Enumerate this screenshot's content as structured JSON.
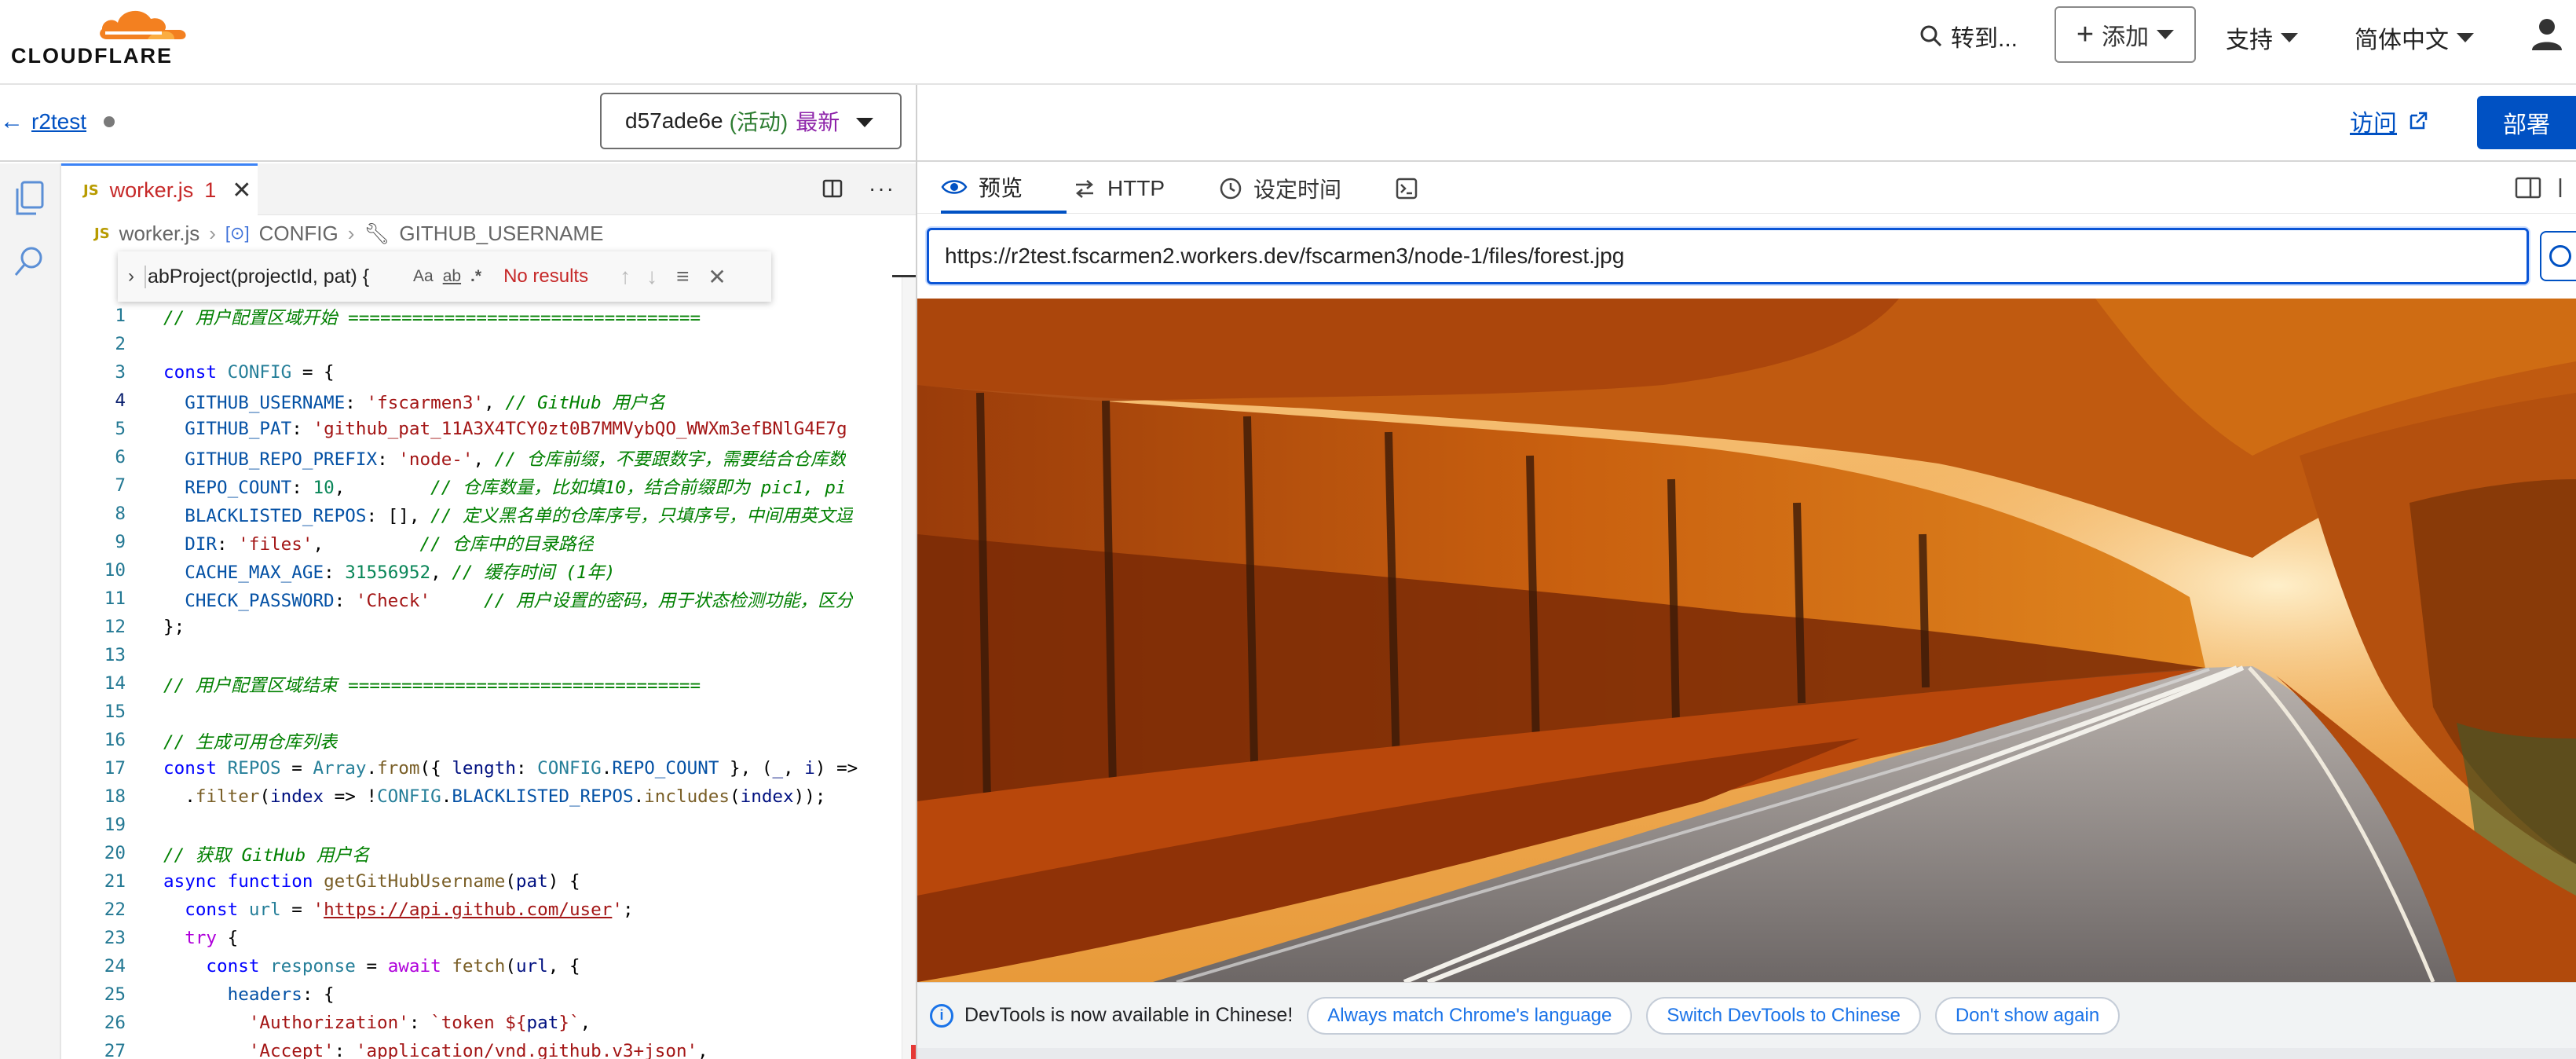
{
  "brand": {
    "logo_text": "CLOUDFLARE"
  },
  "topnav": {
    "goto_label": "转到...",
    "add_label": "添加",
    "support_label": "支持",
    "language_label": "简体中文"
  },
  "worker": {
    "back_label": "r2test",
    "version_id": "d57ade6e",
    "version_status": "(活动)",
    "version_latest": "最新",
    "visit_label": "访问",
    "deploy_label": "部署"
  },
  "editor": {
    "tab": {
      "badge": "JS",
      "filename": "worker.js",
      "problems": "1"
    },
    "breadcrumbs": {
      "file": "worker.js",
      "symbol1": "CONFIG",
      "symbol2": "GITHUB_USERNAME"
    },
    "find": {
      "query": "abProject(projectId, pat) {",
      "opt_case": "Aa",
      "opt_word": "ab",
      "opt_regex": ".*",
      "result": "No results"
    },
    "current_line": 4,
    "lines": [
      {
        "n": "1",
        "html": "<span class=\"cm\">// 用户配置区域开始 =================================</span>"
      },
      {
        "n": "2",
        "html": ""
      },
      {
        "n": "3",
        "html": "<span class=\"kw\">const</span> <span class=\"typ\">CONFIG</span> = {"
      },
      {
        "n": "4",
        "html": "  <span class=\"prop\">GITHUB_USERNAME</span>: <span class=\"str\">'fscarmen3'</span>, <span class=\"cm\">// GitHub 用户名</span>"
      },
      {
        "n": "5",
        "html": "  <span class=\"prop\">GITHUB_PAT</span>: <span class=\"str\">'github_pat_11A3X4TCY0zt0B7MMVybQO_WWXm3efBNlG4E7g</span>"
      },
      {
        "n": "6",
        "html": "  <span class=\"prop\">GITHUB_REPO_PREFIX</span>: <span class=\"str\">'node-'</span>, <span class=\"cm\">// 仓库前缀，不要跟数字，需要结合仓库数</span>"
      },
      {
        "n": "7",
        "html": "  <span class=\"prop\">REPO_COUNT</span>: <span class=\"num\">10</span>,        <span class=\"cm\">// 仓库数量，比如填10，结合前缀即为 pic1, pi</span>"
      },
      {
        "n": "8",
        "html": "  <span class=\"prop\">BLACKLISTED_REPOS</span>: [], <span class=\"cm\">// 定义黑名单的仓库序号，只填序号，中间用英文逗</span>"
      },
      {
        "n": "9",
        "html": "  <span class=\"prop\">DIR</span>: <span class=\"str\">'files'</span>,         <span class=\"cm\">// 仓库中的目录路径</span>"
      },
      {
        "n": "10",
        "html": "  <span class=\"prop\">CACHE_MAX_AGE</span>: <span class=\"num\">31556952</span>, <span class=\"cm\">// 缓存时间 (1年)</span>"
      },
      {
        "n": "11",
        "html": "  <span class=\"prop\">CHECK_PASSWORD</span>: <span class=\"str\">'Check'</span>     <span class=\"cm\">// 用户设置的密码，用于状态检测功能，区分</span>"
      },
      {
        "n": "12",
        "html": "};"
      },
      {
        "n": "13",
        "html": ""
      },
      {
        "n": "14",
        "html": "<span class=\"cm\">// 用户配置区域结束 =================================</span>"
      },
      {
        "n": "15",
        "html": ""
      },
      {
        "n": "16",
        "html": "<span class=\"cm\">// 生成可用仓库列表</span>"
      },
      {
        "n": "17",
        "html": "<span class=\"kw\">const</span> <span class=\"typ\">REPOS</span> = <span class=\"typ\">Array</span>.<span class=\"fn\">from</span>({ <span class=\"var\">length</span>: <span class=\"typ\">CONFIG</span>.<span class=\"prop\">REPO_COUNT</span> }, (<span class=\"var\">_</span>, <span class=\"var\">i</span>) =&gt;"
      },
      {
        "n": "18",
        "html": "  .<span class=\"fn\">filter</span>(<span class=\"var\">index</span> =&gt; !<span class=\"typ\">CONFIG</span>.<span class=\"prop\">BLACKLISTED_REPOS</span>.<span class=\"fn\">includes</span>(<span class=\"var\">index</span>));"
      },
      {
        "n": "19",
        "html": ""
      },
      {
        "n": "20",
        "html": "<span class=\"cm\">// 获取 GitHub 用户名</span>"
      },
      {
        "n": "21",
        "html": "<span class=\"kw\">async</span> <span class=\"kw\">function</span> <span class=\"fn\">getGitHubUsername</span>(<span class=\"var\">pat</span>) {"
      },
      {
        "n": "22",
        "html": "  <span class=\"kw\">const</span> <span class=\"typ\">url</span> = <span class=\"str\">'</span><span class=\"url\">https://api.github.com/user</span><span class=\"str\">'</span>;"
      },
      {
        "n": "23",
        "html": "  <span class=\"kw2\">try</span> {"
      },
      {
        "n": "24",
        "html": "    <span class=\"kw\">const</span> <span class=\"typ\">response</span> = <span class=\"kw2\">await</span> <span class=\"fn\">fetch</span>(<span class=\"var\">url</span>, {"
      },
      {
        "n": "25",
        "html": "      <span class=\"prop\">headers</span>: {"
      },
      {
        "n": "26",
        "html": "        <span class=\"str\">'Authorization'</span>: <span class=\"str\">`token ${</span><span class=\"var\">pat</span><span class=\"str\">}`</span>,"
      },
      {
        "n": "27",
        "html": "        <span class=\"str\">'Accept'</span>: <span class=\"str\">'application/vnd.github.v3+json'</span>,"
      }
    ]
  },
  "preview": {
    "tabs": [
      {
        "label": "预览",
        "icon": "eye-icon"
      },
      {
        "label": "HTTP",
        "icon": "arrows-exchange-icon"
      },
      {
        "label": "设定时间",
        "icon": "clock-icon"
      },
      {
        "label": "",
        "icon": "terminal-icon"
      }
    ],
    "url": "https://r2test.fscarmen2.workers.dev/fscarmen3/node-1/files/forest.jpg",
    "image_alt": "forest road in autumn"
  },
  "devtools_banner": {
    "message": "DevTools is now available in Chinese!",
    "btn_match": "Always match Chrome's language",
    "btn_switch": "Switch DevTools to Chinese",
    "btn_dismiss": "Don't show again"
  },
  "colors": {
    "accent": "#0051c3",
    "orange": "#f38020",
    "error": "#c62828"
  }
}
